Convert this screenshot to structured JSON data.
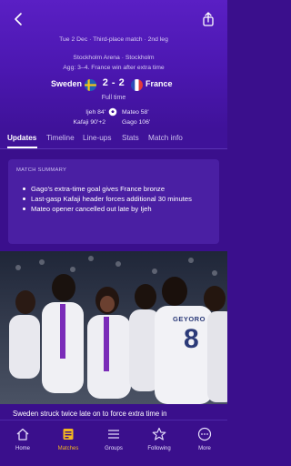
{
  "header": {
    "match_info": "Tue 2 Dec · Third-place match · 2nd leg",
    "venue": "Stockholm Arena · Stockholm",
    "aggregate": "Agg: 3–4. France win after extra time",
    "home_team": "Sweden",
    "away_team": "France",
    "score": "2 - 2",
    "status": "Full time",
    "home_scorers": [
      "Ijeh 84'",
      "Kafaji 90'+2"
    ],
    "away_scorers": [
      "Mateo 58'",
      "Gago 106'"
    ]
  },
  "tabs": [
    "Updates",
    "Timeline",
    "Line-ups",
    "Stats",
    "Match info"
  ],
  "summary": {
    "title": "MATCH SUMMARY",
    "items": [
      "Gago's extra-time goal gives France bronze",
      "Last-gasp Kafaji header forces additional 30 minutes",
      "Mateo opener cancelled out late by Ijeh"
    ]
  },
  "photo": {
    "shirt_name": "GEYORO",
    "shirt_number": "8"
  },
  "caption": "Sweden struck twice late on to force extra time in",
  "nav": {
    "items": [
      {
        "label": "Home",
        "icon": "home-icon"
      },
      {
        "label": "Matches",
        "icon": "matches-icon"
      },
      {
        "label": "Groups",
        "icon": "groups-icon"
      },
      {
        "label": "Following",
        "icon": "star-icon"
      },
      {
        "label": "More",
        "icon": "more-icon"
      }
    ]
  },
  "colors": {
    "background": "#3a0f8c",
    "header": "#5a1fc4",
    "card": "#4a1fa3",
    "active_nav": "#f3b61f"
  }
}
